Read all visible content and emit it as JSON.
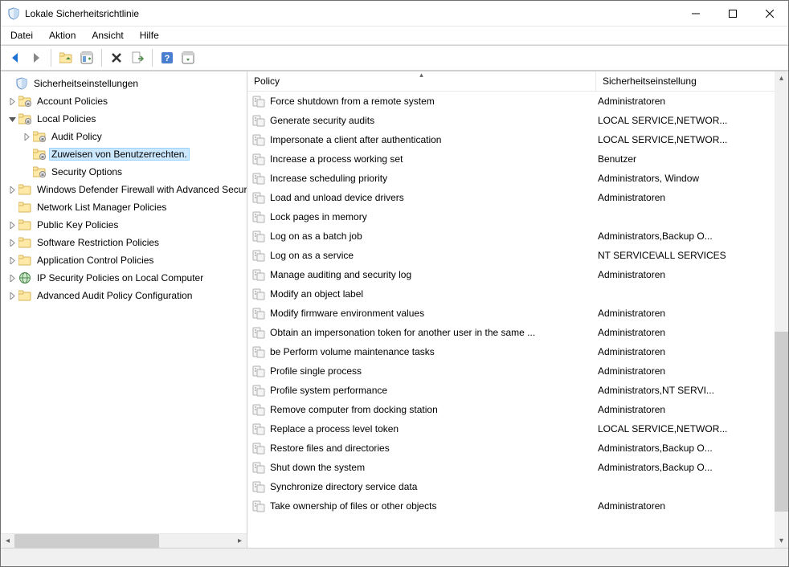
{
  "window": {
    "title": "Lokale Sicherheitsrichtlinie"
  },
  "menu": {
    "file": "Datei",
    "action": "Aktion",
    "view": "Ansicht",
    "help": "Hilfe"
  },
  "tree": {
    "root": "Sicherheitseinstellungen",
    "account_policies": "Account Policies",
    "local_policies": "Local Policies",
    "audit_policy": "Audit Policy",
    "user_rights": "Zuweisen von Benutzerrechten.",
    "security_options": "Security Options",
    "firewall": "Windows Defender Firewall with Advanced Security",
    "nlm": "Network List Manager Policies",
    "pki": "Public Key Policies",
    "srp": "Software Restriction Policies",
    "acp": "Application Control Policies",
    "ipsec": "IP Security Policies on Local Computer",
    "advanced_audit": "Advanced Audit Policy Configuration"
  },
  "columns": {
    "policy": "Policy",
    "setting": "Sicherheitseinstellung"
  },
  "policies": [
    {
      "name": "Force shutdown from a remote system",
      "setting": "Administratoren"
    },
    {
      "name": "Generate security audits",
      "setting": "LOCAL SERVICE,NETWOR..."
    },
    {
      "name": "Impersonate a client after authentication",
      "setting": "LOCAL SERVICE,NETWOR..."
    },
    {
      "name": "Increase a process working set",
      "setting": "Benutzer"
    },
    {
      "name": "Increase scheduling priority",
      "setting": "Administrators, Window"
    },
    {
      "name": "Load and unload device drivers",
      "setting": "Administratoren"
    },
    {
      "name": "Lock pages in memory",
      "setting": ""
    },
    {
      "name": "Log on as a batch job",
      "setting": "Administrators,Backup O..."
    },
    {
      "name": "Log on as a service",
      "setting": "NT SERVICE\\ALL SERVICES"
    },
    {
      "name": "Manage auditing and security log",
      "setting": "Administratoren"
    },
    {
      "name": "Modify an object label",
      "setting": ""
    },
    {
      "name": "Modify firmware environment values",
      "setting": "Administratoren"
    },
    {
      "name": "Obtain an impersonation token for another user in the same ...",
      "setting": "Administratoren"
    },
    {
      "name": "be Perform volume maintenance tasks",
      "setting": "Administratoren"
    },
    {
      "name": "Profile single process",
      "setting": "Administratoren"
    },
    {
      "name": "Profile system performance",
      "setting": "Administrators,NT SERVI..."
    },
    {
      "name": "Remove computer from docking station",
      "setting": "Administratoren"
    },
    {
      "name": "Replace a process level token",
      "setting": "LOCAL SERVICE,NETWOR..."
    },
    {
      "name": "Restore files and directories",
      "setting": "Administrators,Backup O..."
    },
    {
      "name": "Shut down the system",
      "setting": "Administrators,Backup O..."
    },
    {
      "name": "Synchronize directory service data",
      "setting": ""
    },
    {
      "name": "Take ownership of files or other objects",
      "setting": "Administratoren"
    }
  ]
}
